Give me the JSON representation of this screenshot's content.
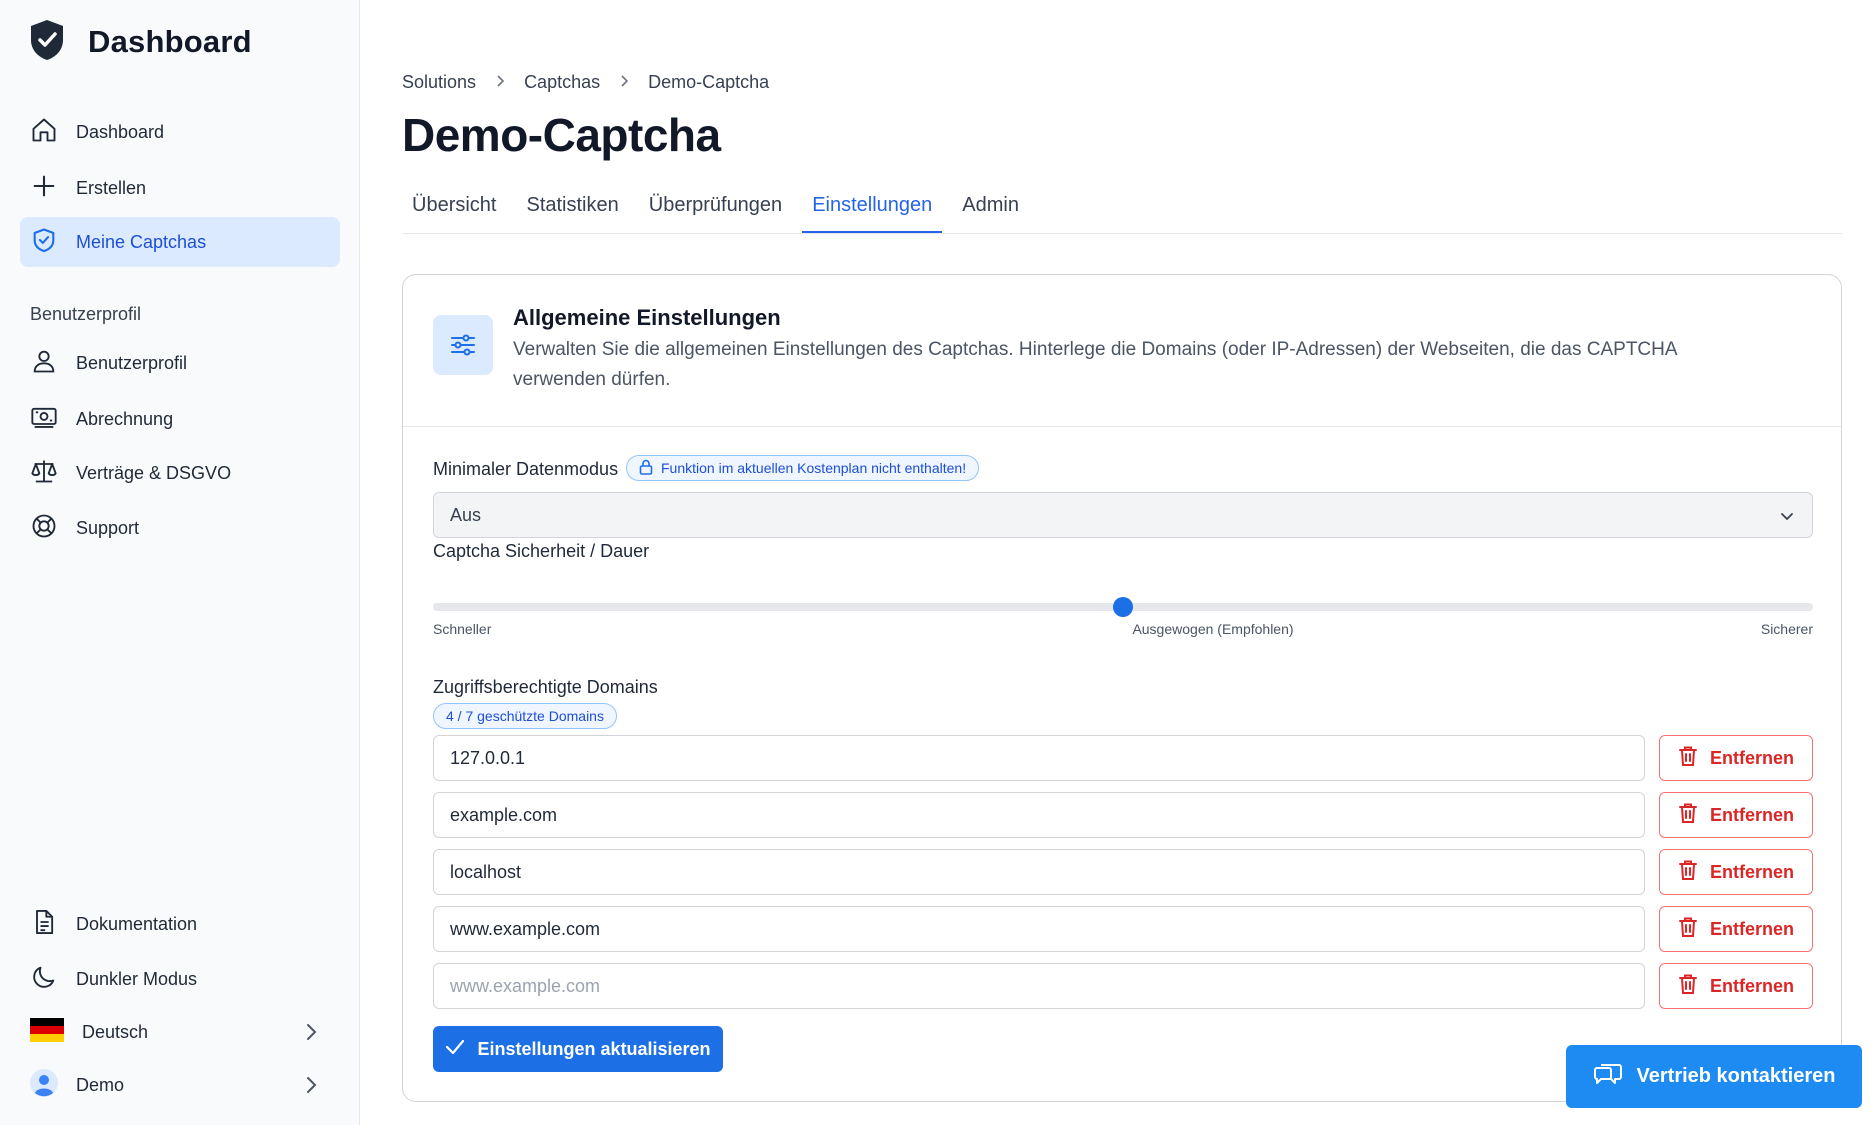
{
  "sidebar": {
    "brand_title": "Dashboard",
    "nav": [
      {
        "label": "Dashboard",
        "icon": "home-icon"
      },
      {
        "label": "Erstellen",
        "icon": "plus-icon"
      },
      {
        "label": "Meine Captchas",
        "icon": "shield-check-icon",
        "active": true
      }
    ],
    "section_label": "Benutzerprofil",
    "profile_nav": [
      {
        "label": "Benutzerprofil",
        "icon": "user-icon"
      },
      {
        "label": "Abrechnung",
        "icon": "banknote-icon"
      },
      {
        "label": "Verträge & DSGVO",
        "icon": "scale-icon"
      },
      {
        "label": "Support",
        "icon": "lifebuoy-icon"
      }
    ],
    "bottom_nav": [
      {
        "label": "Dokumentation",
        "icon": "document-icon"
      },
      {
        "label": "Dunkler Modus",
        "icon": "moon-icon"
      },
      {
        "label": "Deutsch",
        "icon": "german-flag-icon"
      },
      {
        "label": "Demo",
        "icon": "user-avatar-icon"
      }
    ]
  },
  "breadcrumb": [
    "Solutions",
    "Captchas",
    "Demo-Captcha"
  ],
  "page_title": "Demo-Captcha",
  "tabs": [
    "Übersicht",
    "Statistiken",
    "Überprüfungen",
    "Einstellungen",
    "Admin"
  ],
  "active_tab": "Einstellungen",
  "card": {
    "title": "Allgemeine Einstellungen",
    "description": "Verwalten Sie die allgemeinen Einstellungen des Captchas. Hinterlege die Domains (oder IP-Adressen) der Webseiten, die das CAPTCHA verwenden dürfen.",
    "data_mode": {
      "label": "Minimaler Datenmodus",
      "locked_badge": "Funktion im aktuellen Kostenplan nicht enthalten!",
      "selected_value": "Aus"
    },
    "security": {
      "label": "Captcha Sicherheit / Dauer",
      "min_label": "Schneller",
      "mid_label": "Ausgewogen (Empfohlen)",
      "max_label": "Sicherer",
      "value_fraction": 0.5
    },
    "domains": {
      "label": "Zugriffsberechtigte Domains",
      "count_badge": "4 / 7 geschützte Domains",
      "entries": [
        "127.0.0.1",
        "example.com",
        "localhost",
        "www.example.com",
        ""
      ],
      "placeholder": "www.example.com",
      "remove_label": "Entfernen"
    },
    "save_label": "Einstellungen aktualisieren"
  },
  "contact_label": "Vertrieb kontaktieren",
  "colors": {
    "accent": "#1d6fe6",
    "danger": "#dc2626",
    "active_nav_bg": "#dbeafe"
  }
}
